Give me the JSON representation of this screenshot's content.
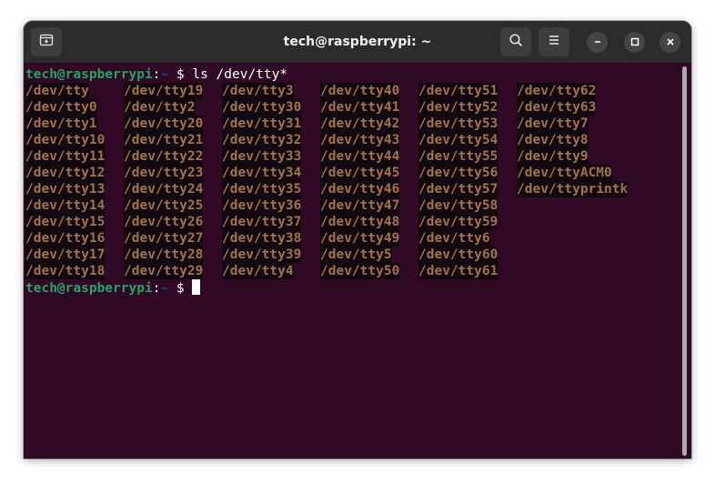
{
  "window": {
    "title": "tech@raspberrypi: ~"
  },
  "titlebar": {
    "new_tab_icon": "new-tab-icon",
    "search_icon": "search-icon",
    "menu_icon": "hamburger-menu-icon",
    "minimize_icon": "minimize-icon",
    "maximize_icon": "maximize-icon",
    "close_icon": "close-icon"
  },
  "colors": {
    "terminal_bg": "#300a24",
    "prompt_user": "#26a269",
    "prompt_path": "#12488b",
    "device_text": "#a2734c"
  },
  "terminal": {
    "prompt1": {
      "user": "tech@raspberrypi",
      "colon": ":",
      "path": "~",
      "dollar": " $ ",
      "command": "ls /dev/tty*"
    },
    "prompt2": {
      "user": "tech@raspberrypi",
      "colon": ":",
      "path": "~",
      "dollar": " $ "
    },
    "columns": [
      [
        "/dev/tty",
        "/dev/tty0",
        "/dev/tty1",
        "/dev/tty10",
        "/dev/tty11",
        "/dev/tty12",
        "/dev/tty13",
        "/dev/tty14",
        "/dev/tty15",
        "/dev/tty16",
        "/dev/tty17",
        "/dev/tty18"
      ],
      [
        "/dev/tty19",
        "/dev/tty2",
        "/dev/tty20",
        "/dev/tty21",
        "/dev/tty22",
        "/dev/tty23",
        "/dev/tty24",
        "/dev/tty25",
        "/dev/tty26",
        "/dev/tty27",
        "/dev/tty28",
        "/dev/tty29"
      ],
      [
        "/dev/tty3",
        "/dev/tty30",
        "/dev/tty31",
        "/dev/tty32",
        "/dev/tty33",
        "/dev/tty34",
        "/dev/tty35",
        "/dev/tty36",
        "/dev/tty37",
        "/dev/tty38",
        "/dev/tty39",
        "/dev/tty4"
      ],
      [
        "/dev/tty40",
        "/dev/tty41",
        "/dev/tty42",
        "/dev/tty43",
        "/dev/tty44",
        "/dev/tty45",
        "/dev/tty46",
        "/dev/tty47",
        "/dev/tty48",
        "/dev/tty49",
        "/dev/tty5",
        "/dev/tty50"
      ],
      [
        "/dev/tty51",
        "/dev/tty52",
        "/dev/tty53",
        "/dev/tty54",
        "/dev/tty55",
        "/dev/tty56",
        "/dev/tty57",
        "/dev/tty58",
        "/dev/tty59",
        "/dev/tty6",
        "/dev/tty60",
        "/dev/tty61"
      ],
      [
        "/dev/tty62",
        "/dev/tty63",
        "/dev/tty7",
        "/dev/tty8",
        "/dev/tty9",
        "/dev/ttyACM0",
        "/dev/ttyprintk"
      ]
    ]
  }
}
